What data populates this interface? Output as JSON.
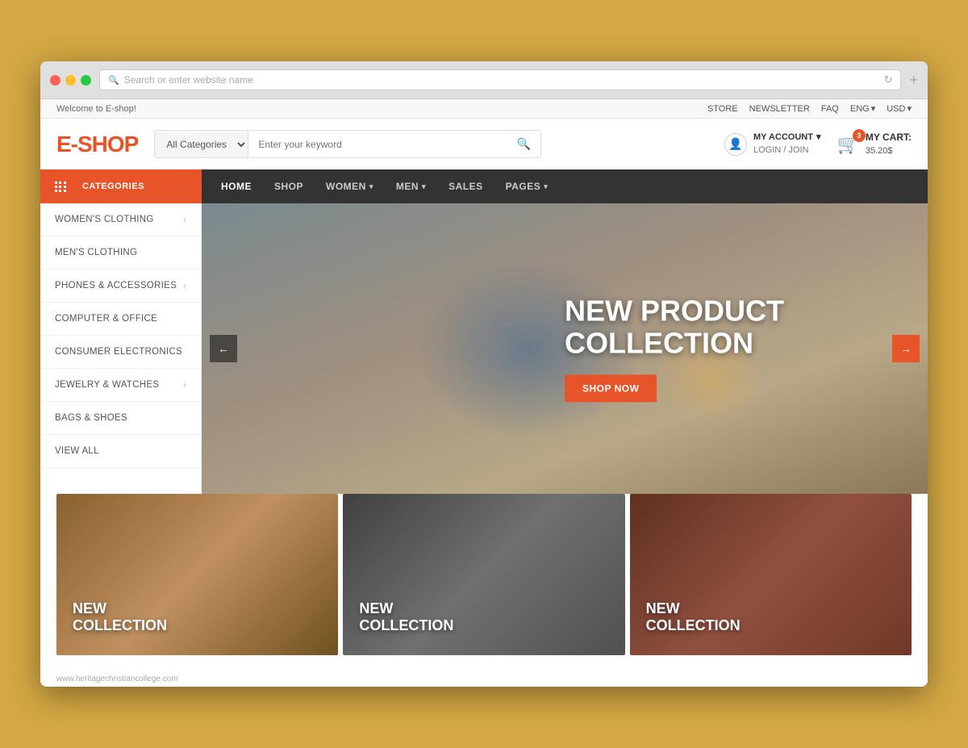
{
  "browser": {
    "address": "Search or enter website name",
    "add_icon": "+"
  },
  "topbar": {
    "welcome": "Welcome to E-shop!",
    "store": "STORE",
    "newsletter": "NEWSLETTER",
    "faq": "FAQ",
    "lang": "ENG",
    "currency": "USD"
  },
  "header": {
    "logo_e": "E-",
    "logo_shop": "SHOP",
    "category_default": "All Categories",
    "search_placeholder": "Enter your keyword",
    "account_label": "MY ACCOUNT",
    "account_sub": "LOGIN / JOIN",
    "cart_label": "MY CART:",
    "cart_amount": "35.20$",
    "cart_count": "3"
  },
  "nav": {
    "categories_label": "CATEGORIES",
    "items": [
      {
        "label": "HOME",
        "has_dropdown": false
      },
      {
        "label": "SHOP",
        "has_dropdown": false
      },
      {
        "label": "WOMEN",
        "has_dropdown": true
      },
      {
        "label": "MEN",
        "has_dropdown": true
      },
      {
        "label": "SALES",
        "has_dropdown": false
      },
      {
        "label": "PAGES",
        "has_dropdown": true
      }
    ]
  },
  "sidebar": {
    "items": [
      {
        "label": "WOMEN'S CLOTHING",
        "has_arrow": true
      },
      {
        "label": "MEN'S CLOTHING",
        "has_arrow": false
      },
      {
        "label": "PHONES & ACCESSORIES",
        "has_arrow": true
      },
      {
        "label": "COMPUTER & OFFICE",
        "has_arrow": false
      },
      {
        "label": "CONSUMER ELECTRONICS",
        "has_arrow": false
      },
      {
        "label": "JEWELRY & WATCHES",
        "has_arrow": true
      },
      {
        "label": "BAGS & SHOES",
        "has_arrow": false
      },
      {
        "label": "VIEW ALL",
        "has_arrow": false
      }
    ]
  },
  "hero": {
    "title_line1": "NEW PRODUCT",
    "title_line2": "COLLECTION",
    "cta": "SHOP NOW"
  },
  "promo": {
    "cards": [
      {
        "line1": "NEW",
        "line2": "COLLECTION"
      },
      {
        "line1": "NEW",
        "line2": "COLLECTION"
      },
      {
        "line1": "NEW",
        "line2": "COLLECTION"
      }
    ]
  },
  "footer_url": "www.heritagechristiancollege.com"
}
